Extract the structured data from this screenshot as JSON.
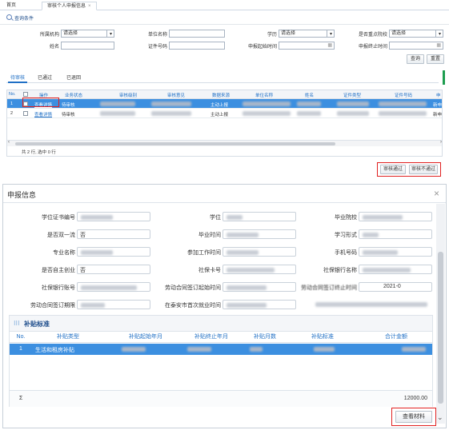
{
  "tabs": [
    {
      "label": "首页"
    },
    {
      "label": "审核个人申报信息",
      "close": "×"
    }
  ],
  "query": {
    "header": "查询条件",
    "fields": {
      "org_label": "所属机构",
      "org_value": "请选择",
      "company_label": "单位名称",
      "edu_label": "学历",
      "edu_value": "请选择",
      "key_school_label": "是否重点院校",
      "key_school_value": "请选择",
      "name_label": "姓名",
      "id_label": "证件号码",
      "apply_start_label": "申报起始时间",
      "apply_end_label": "申报终止时间"
    },
    "search_button": "查询",
    "reset_button": "重置"
  },
  "subtabs": [
    "待审核",
    "已通过",
    "已退回"
  ],
  "grid": {
    "columns": [
      "No.",
      "操作",
      "业务状态",
      "审核级别",
      "审核意见",
      "数据来源",
      "单位名称",
      "姓名",
      "证件类型",
      "证件号码",
      "申"
    ],
    "rows": [
      {
        "no": "1",
        "action": "查看详情",
        "status": "待审核",
        "source": "主动上报",
        "extra": "新申"
      },
      {
        "no": "2",
        "action": "查看详情",
        "status": "待审核",
        "source": "主动上报",
        "extra": "新申"
      }
    ],
    "footer": "共 2 行, 选中 0 行"
  },
  "actions": {
    "approve": "审核通过",
    "reject": "审核不通过"
  },
  "modal": {
    "title": "申报信息",
    "close": "×",
    "fields": [
      {
        "label": "学位证书编号",
        "value": ""
      },
      {
        "label": "学位",
        "value": ""
      },
      {
        "label": "毕业院校",
        "value": ""
      },
      {
        "label": "是否双一流",
        "value": "否"
      },
      {
        "label": "毕业时间",
        "value": ""
      },
      {
        "label": "学习形式",
        "value": ""
      },
      {
        "label": "专业名称",
        "value": ""
      },
      {
        "label": "参加工作时间",
        "value": ""
      },
      {
        "label": "手机号码",
        "value": ""
      },
      {
        "label": "是否自主创业",
        "value": "否"
      },
      {
        "label": "社保卡号",
        "value": ""
      },
      {
        "label": "社保银行名称",
        "value": ""
      },
      {
        "label": "社保银行账号",
        "value": ""
      },
      {
        "label": "劳动合同签订起始时间",
        "value": ""
      },
      {
        "label": "劳动合同签订终止时间",
        "value": "2021-0"
      },
      {
        "label": "劳动合同签订期限",
        "value": ""
      },
      {
        "label": "在泰安市首次就业时间",
        "value": ""
      }
    ],
    "subsidy": {
      "title": "补贴标准",
      "columns": [
        "No.",
        "补贴类型",
        "补贴起始年月",
        "补贴终止年月",
        "补贴月数",
        "补贴标准",
        "合计金额"
      ],
      "rows": [
        {
          "no": "1",
          "type": "生活和租房补贴"
        }
      ],
      "sum_symbol": "Σ",
      "total": "12000.00"
    },
    "view_materials": "查看材料"
  },
  "colors": {
    "accent": "#1f6fc5",
    "highlight_row": "#3c8fe0",
    "red_box": "#e02020"
  }
}
